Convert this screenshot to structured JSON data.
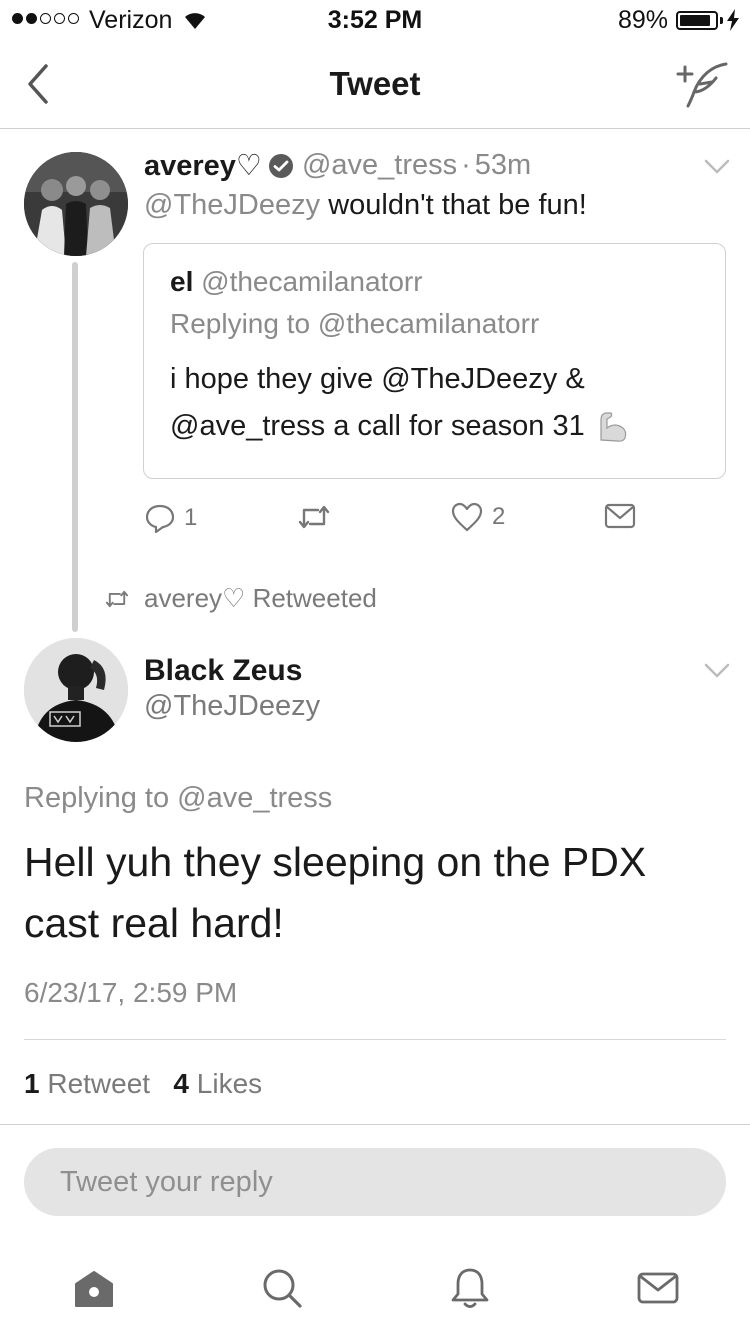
{
  "status_bar": {
    "carrier": "Verizon",
    "time": "3:52 PM",
    "battery_percent": "89%",
    "battery_level": 0.89,
    "signal_bars": 2,
    "signal_total": 5
  },
  "nav": {
    "title": "Tweet",
    "back_icon": "chevron-left-icon",
    "compose_icon": "compose-tweet-icon"
  },
  "parent_tweet": {
    "name": "averey♡",
    "verified": true,
    "handle": "@ave_tress",
    "separator": "·",
    "age": "53m",
    "mention": "@TheJDeezy",
    "text": "wouldn't that be fun!",
    "quote": {
      "name": "el",
      "handle": "@thecamilanatorr",
      "replying_label": "Replying to @thecamilanatorr",
      "text": "i hope they give @TheJDeezy & @ave_tress a call for season 31",
      "emoji": "flexed-biceps-emoji"
    },
    "actions": {
      "reply_count": "1",
      "retweet_count": "",
      "like_count": "2"
    }
  },
  "retweet_context": {
    "text": "averey♡ Retweeted"
  },
  "main_tweet": {
    "name": "Black Zeus",
    "handle": "@TheJDeezy",
    "replying_label": "Replying to @ave_tress",
    "text": "Hell yuh they sleeping on the PDX cast real hard!",
    "timestamp": "6/23/17, 2:59 PM",
    "retweet_count": "1",
    "retweet_label": "Retweet",
    "like_count": "4",
    "like_label": "Likes"
  },
  "reply_box": {
    "placeholder": "Tweet your reply"
  },
  "tabbar": {
    "items": [
      "home-icon",
      "search-icon",
      "notifications-icon",
      "messages-icon"
    ]
  },
  "colors": {
    "text": "#1a1a1a",
    "muted": "#8a8a8a",
    "divider": "#d0d0d0",
    "reply_box_bg": "#e4e4e4"
  }
}
